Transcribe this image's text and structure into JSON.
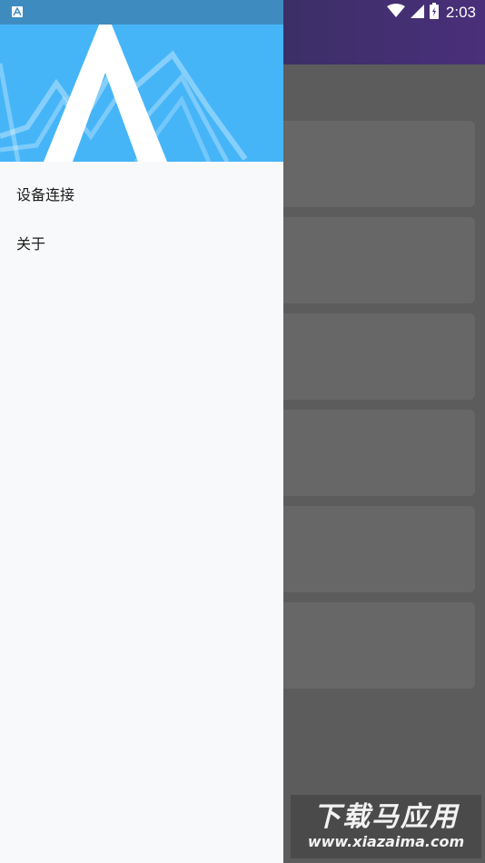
{
  "status_bar": {
    "notification_icon": "app-a-icon",
    "wifi_icon": "wifi-icon",
    "signal_icon": "cell-signal-icon",
    "battery_icon": "battery-charging-icon",
    "time": "2:03"
  },
  "drawer": {
    "header_logo": "a-logo",
    "menu": [
      {
        "label": "设备连接"
      },
      {
        "label": "关于"
      }
    ]
  },
  "watermark": {
    "title": "下载马应用",
    "url": "www.xiazaima.com"
  },
  "colors": {
    "drawer_header": "#46b5f8",
    "status_bar_left": "#3e8cbf",
    "toolbar": "#3c2f68",
    "scrim": "#5c5c5c",
    "drawer_bg": "#f8f9fa"
  }
}
